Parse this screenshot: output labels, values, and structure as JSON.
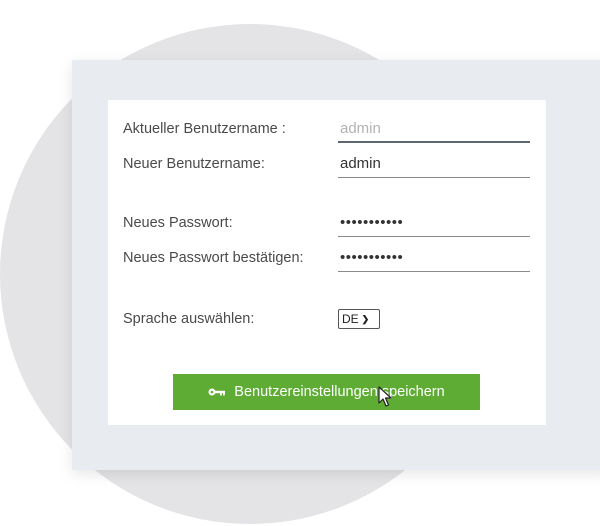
{
  "form": {
    "current_username": {
      "label": "Aktueller Benutzername :",
      "placeholder": "admin"
    },
    "new_username": {
      "label": "Neuer Benutzername:",
      "value": "admin"
    },
    "new_password": {
      "label": "Neues Passwort:",
      "value": "•••••••••••"
    },
    "confirm_password": {
      "label": "Neues Passwort bestätigen:",
      "value": "•••••••••••"
    },
    "language": {
      "label": "Sprache auswählen:",
      "selected": "DE"
    },
    "save_button": {
      "label": "Benutzereinstellungen speichern",
      "icon": "key-icon"
    }
  },
  "colors": {
    "button": "#5eac34",
    "panel": "#e8ebef",
    "circle": "#e4e4e6"
  }
}
